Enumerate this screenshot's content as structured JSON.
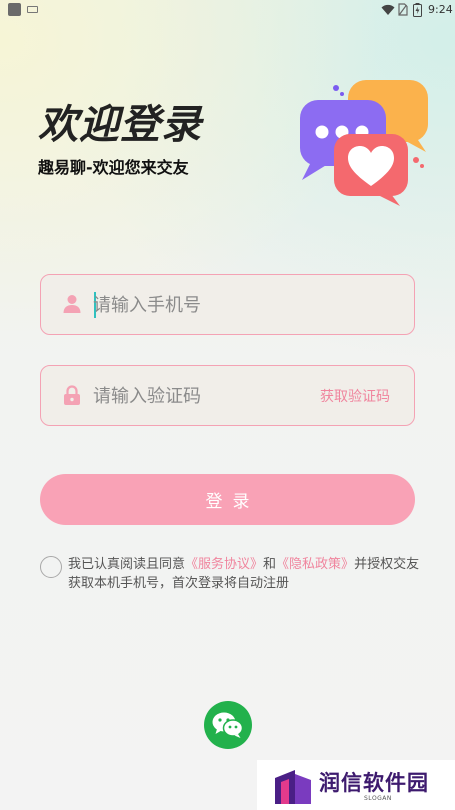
{
  "status_bar": {
    "time": "9:24",
    "icons": [
      "app-notification-icon",
      "keyboard-icon",
      "wifi-icon",
      "no-sim-icon",
      "battery-charging-icon"
    ]
  },
  "header": {
    "title": "欢迎登录",
    "subtitle": "趣易聊-欢迎您来交友",
    "illustration": "chat-bubbles-heart-icon"
  },
  "phone_field": {
    "icon": "user-icon",
    "placeholder": "请输入手机号",
    "value": ""
  },
  "code_field": {
    "icon": "lock-icon",
    "placeholder": "请输入验证码",
    "value": "",
    "get_code_label": "获取验证码"
  },
  "login_button": {
    "label": "登录"
  },
  "agreement": {
    "checked": false,
    "text_before": "我已认真阅读且同意",
    "service_link": "《服务协议》",
    "and": "和",
    "privacy_link": "《隐私政策》",
    "text_after": "并授权交友获取本机手机号，首次登录将自动注册"
  },
  "social_login": {
    "icon": "wechat-icon"
  },
  "watermark": {
    "name": "润信软件园",
    "slogan": "SLOGAN"
  },
  "colors": {
    "accent_pink": "#f9a2b6",
    "link_pink": "#f0859e",
    "wechat_green": "#22b14c",
    "cursor_teal": "#2fc1bf"
  }
}
